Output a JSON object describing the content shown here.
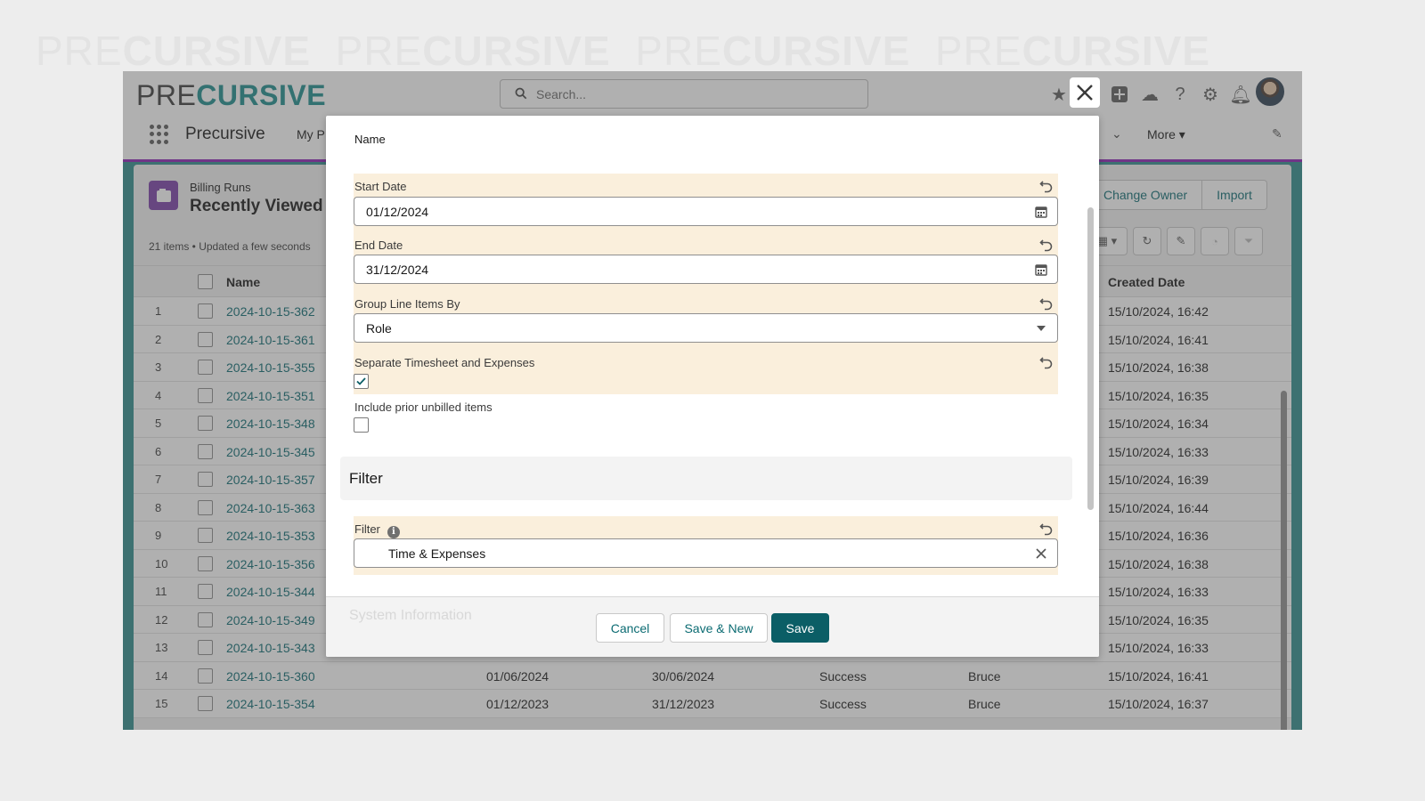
{
  "watermark": {
    "pre": "PRE",
    "cursive": "CURSIVE"
  },
  "header": {
    "logo_pre": "PRE",
    "logo_cursive": "CURSIVE",
    "search_placeholder": "Search..."
  },
  "nav": {
    "app_name": "Precursive",
    "tab_partial": "My P",
    "more_label": "More"
  },
  "list_view": {
    "object_label": "Billing Runs",
    "title": "Recently Viewed",
    "meta": "21 items • Updated a few seconds",
    "buttons": [
      "Change Owner",
      "Import"
    ],
    "columns": {
      "name": "Name",
      "created": "Created Date"
    },
    "rows": [
      {
        "n": "1",
        "name": "2024-10-15-362",
        "c1": "",
        "c2": "",
        "c3": "",
        "c4": "",
        "created": "15/10/2024, 16:42"
      },
      {
        "n": "2",
        "name": "2024-10-15-361",
        "c1": "",
        "c2": "",
        "c3": "",
        "c4": "",
        "created": "15/10/2024, 16:41"
      },
      {
        "n": "3",
        "name": "2024-10-15-355",
        "c1": "",
        "c2": "",
        "c3": "",
        "c4": "",
        "created": "15/10/2024, 16:38"
      },
      {
        "n": "4",
        "name": "2024-10-15-351",
        "c1": "",
        "c2": "",
        "c3": "",
        "c4": "",
        "created": "15/10/2024, 16:35"
      },
      {
        "n": "5",
        "name": "2024-10-15-348",
        "c1": "",
        "c2": "",
        "c3": "",
        "c4": "",
        "created": "15/10/2024, 16:34"
      },
      {
        "n": "6",
        "name": "2024-10-15-345",
        "c1": "",
        "c2": "",
        "c3": "",
        "c4": "",
        "created": "15/10/2024, 16:33"
      },
      {
        "n": "7",
        "name": "2024-10-15-357",
        "c1": "",
        "c2": "",
        "c3": "",
        "c4": "",
        "created": "15/10/2024, 16:39"
      },
      {
        "n": "8",
        "name": "2024-10-15-363",
        "c1": "",
        "c2": "",
        "c3": "",
        "c4": "",
        "created": "15/10/2024, 16:44"
      },
      {
        "n": "9",
        "name": "2024-10-15-353",
        "c1": "",
        "c2": "",
        "c3": "",
        "c4": "",
        "created": "15/10/2024, 16:36"
      },
      {
        "n": "10",
        "name": "2024-10-15-356",
        "c1": "",
        "c2": "",
        "c3": "",
        "c4": "",
        "created": "15/10/2024, 16:38"
      },
      {
        "n": "11",
        "name": "2024-10-15-344",
        "c1": "",
        "c2": "",
        "c3": "",
        "c4": "",
        "created": "15/10/2024, 16:33"
      },
      {
        "n": "12",
        "name": "2024-10-15-349",
        "c1": "",
        "c2": "",
        "c3": "",
        "c4": "",
        "created": "15/10/2024, 16:35"
      },
      {
        "n": "13",
        "name": "2024-10-15-343",
        "c1": "",
        "c2": "",
        "c3": "",
        "c4": "",
        "created": "15/10/2024, 16:33"
      },
      {
        "n": "14",
        "name": "2024-10-15-360",
        "c1": "01/06/2024",
        "c2": "30/06/2024",
        "c3": "Success",
        "c4": "Bruce",
        "created": "15/10/2024, 16:41"
      },
      {
        "n": "15",
        "name": "2024-10-15-354",
        "c1": "01/12/2023",
        "c2": "31/12/2023",
        "c3": "Success",
        "c4": "Bruce",
        "created": "15/10/2024, 16:37"
      }
    ]
  },
  "modal": {
    "name_label": "Name",
    "start_date": {
      "label": "Start Date",
      "value": "01/12/2024"
    },
    "end_date": {
      "label": "End Date",
      "value": "31/12/2024"
    },
    "group_by": {
      "label": "Group Line Items By",
      "value": "Role"
    },
    "separate": {
      "label": "Separate Timesheet and Expenses",
      "checked": true
    },
    "include_prior": {
      "label": "Include prior unbilled items",
      "checked": false
    },
    "filter_section_title": "Filter",
    "filter": {
      "label": "Filter",
      "value": "Time & Expenses"
    },
    "system_info_ghost": "System Information",
    "cancel_label": "Cancel",
    "save_new_label": "Save & New",
    "save_label": "Save"
  },
  "colors": {
    "brand_teal": "#1d8c8c",
    "button_brand": "#0b5e66",
    "changed_field_bg": "#faefdc",
    "nav_accent": "#8b1fb4"
  }
}
